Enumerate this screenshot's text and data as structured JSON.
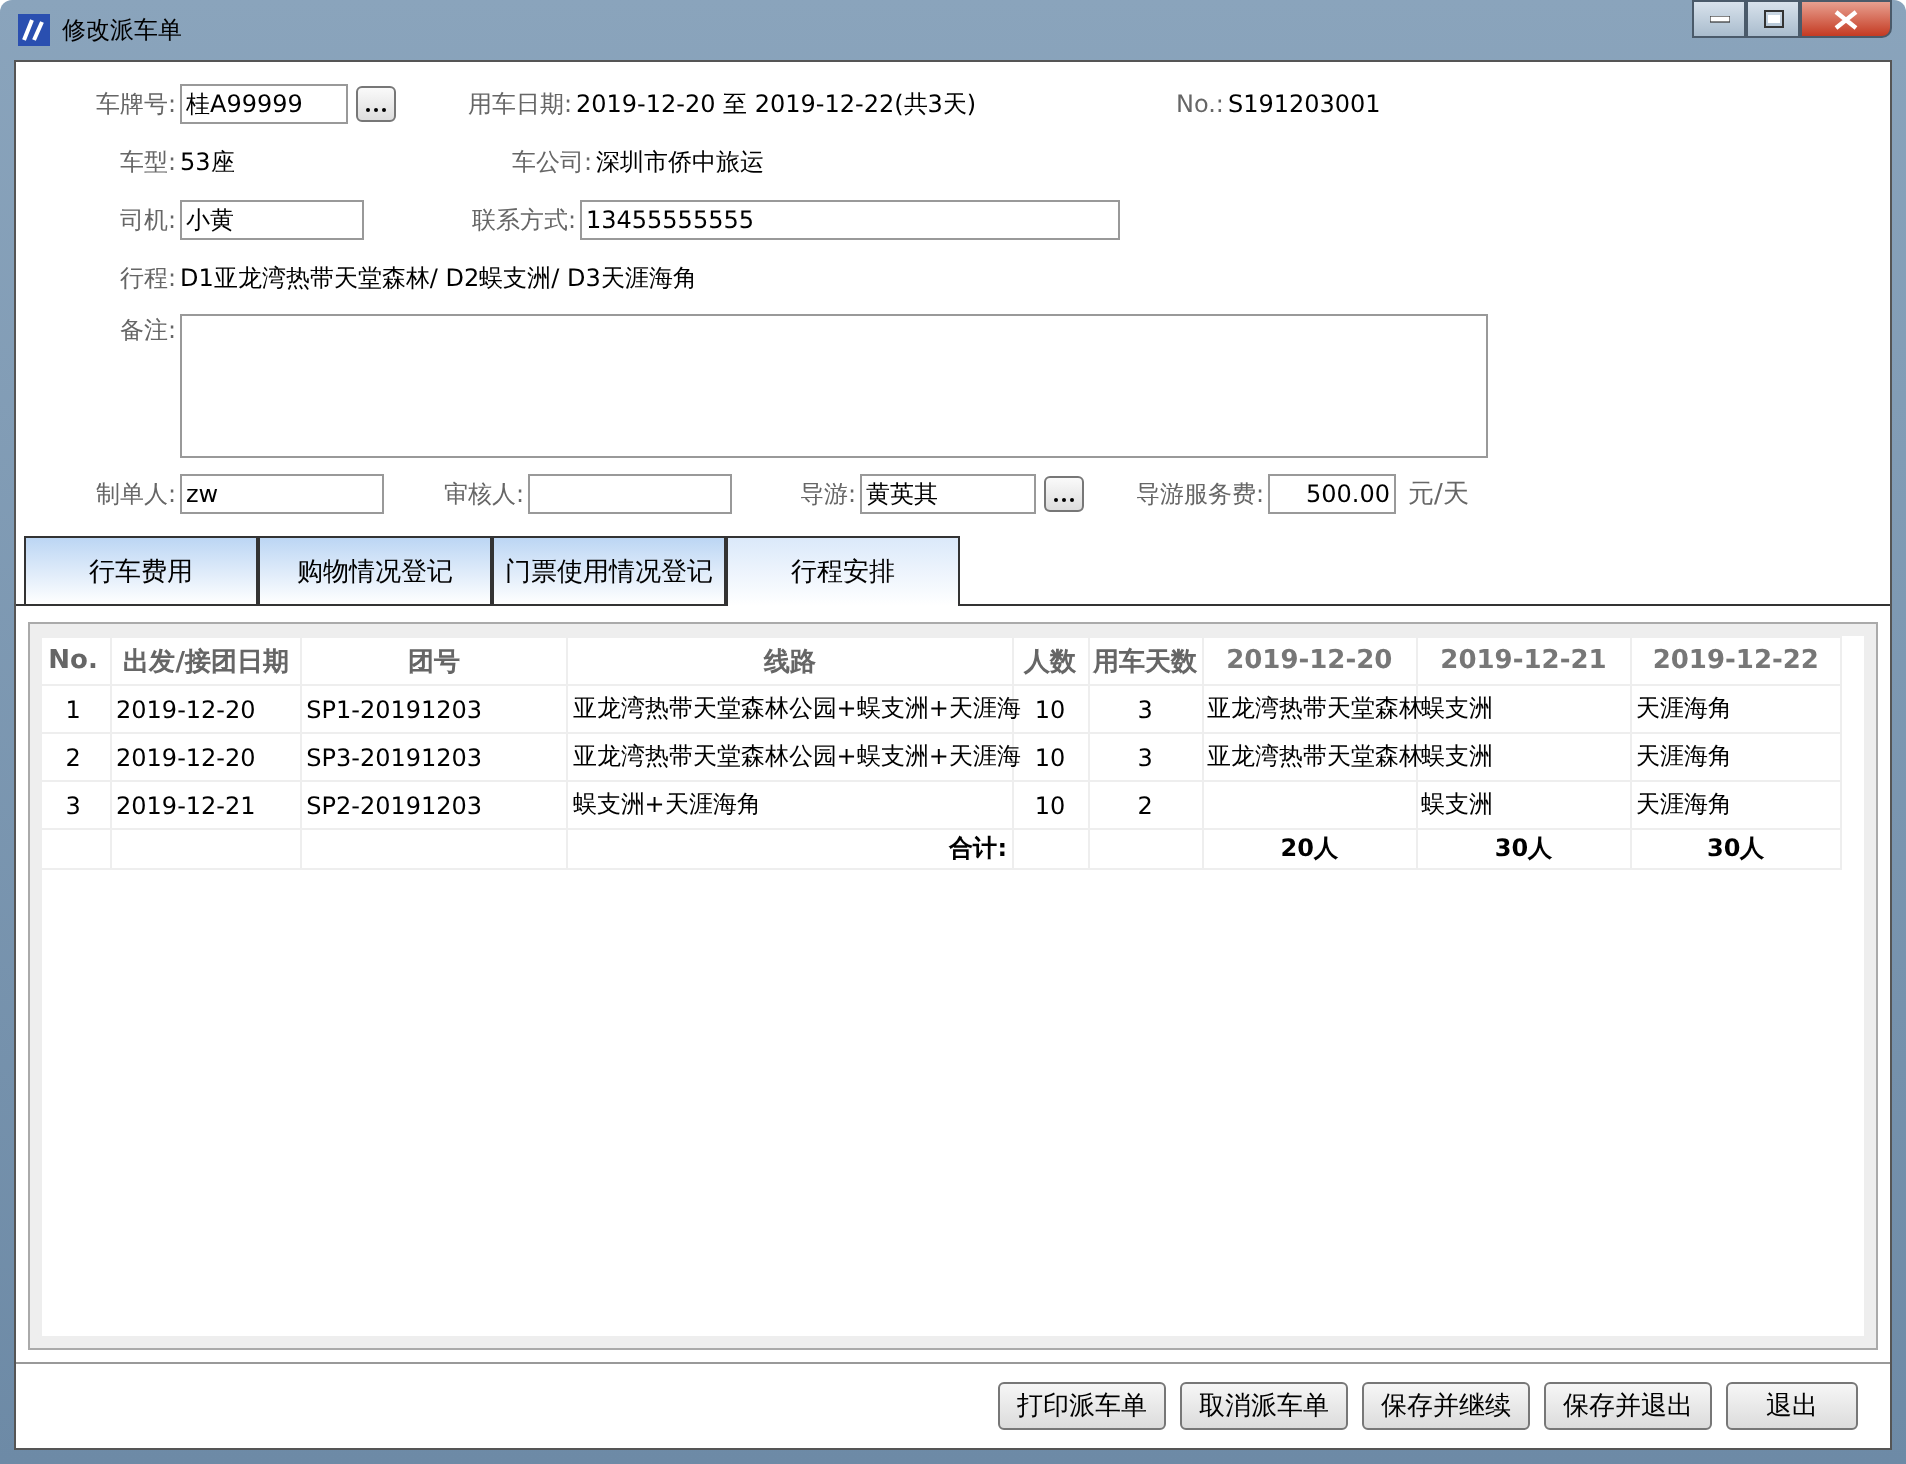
{
  "window": {
    "title": "修改派车单"
  },
  "form": {
    "plate": {
      "label": "车牌号:",
      "value": "桂A99999"
    },
    "dates": {
      "label": "用车日期:",
      "value": "2019-12-20 至 2019-12-22(共3天)"
    },
    "number": {
      "label": "No.:",
      "value": "S191203001"
    },
    "car_type": {
      "label": "车型:",
      "value": "53座"
    },
    "company": {
      "label": "车公司:",
      "value": "深圳市侨中旅运"
    },
    "driver": {
      "label": "司机:",
      "value": "小黄"
    },
    "contact": {
      "label": "联系方式:",
      "value": "13455555555"
    },
    "itinerary": {
      "label": "行程:",
      "value": "D1亚龙湾热带天堂森林/ D2蜈支洲/ D3天涯海角"
    },
    "remarks": {
      "label": "备注:"
    },
    "creator": {
      "label": "制单人:",
      "value": "zw"
    },
    "reviewer": {
      "label": "审核人:"
    },
    "guide": {
      "label": "导游:",
      "value": "黄英其"
    },
    "guide_fee": {
      "label": "导游服务费:",
      "value": "500.00",
      "unit": "元/天"
    }
  },
  "tabs": [
    {
      "label": "行车费用",
      "selected": false
    },
    {
      "label": "购物情况登记",
      "selected": false
    },
    {
      "label": "门票使用情况登记",
      "selected": false
    },
    {
      "label": "行程安排",
      "selected": true
    }
  ],
  "table": {
    "columns": [
      "No.",
      "出发/接团日期",
      "团号",
      "线路",
      "人数",
      "用车天数",
      "2019-12-20",
      "2019-12-21",
      "2019-12-22"
    ],
    "rows": [
      [
        "1",
        "2019-12-20",
        "SP1-20191203",
        "亚龙湾热带天堂森林公园+蜈支洲+天涯海",
        "10",
        "3",
        "亚龙湾热带天堂森林",
        "蜈支洲",
        "天涯海角"
      ],
      [
        "2",
        "2019-12-20",
        "SP3-20191203",
        "亚龙湾热带天堂森林公园+蜈支洲+天涯海",
        "10",
        "3",
        "亚龙湾热带天堂森林",
        "蜈支洲",
        "天涯海角"
      ],
      [
        "3",
        "2019-12-21",
        "SP2-20191203",
        "蜈支洲+天涯海角",
        "10",
        "2",
        "",
        "蜈支洲",
        "天涯海角"
      ]
    ],
    "total": {
      "label": "合计:",
      "values": [
        "20人",
        "30人",
        "30人"
      ]
    }
  },
  "buttons": [
    "打印派车单",
    "取消派车单",
    "保存并继续",
    "保存并退出",
    "退出"
  ]
}
